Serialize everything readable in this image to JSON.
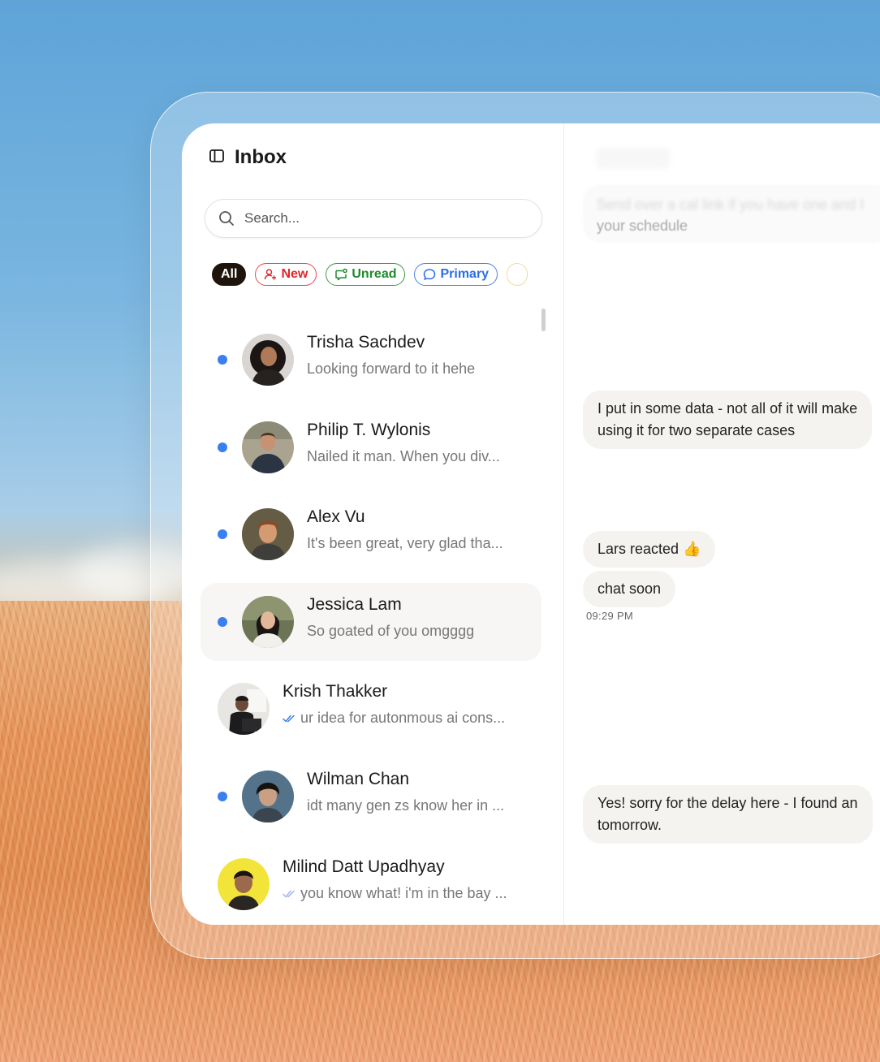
{
  "inbox": {
    "title": "Inbox",
    "search_placeholder": "Search...",
    "filters": [
      {
        "label": "All",
        "color": "#1f140b"
      },
      {
        "label": "New",
        "color": "#e02727"
      },
      {
        "label": "Unread",
        "color": "#1f8a2a"
      },
      {
        "label": "Primary",
        "color": "#2b6ee6"
      }
    ],
    "conversations": [
      {
        "name": "Trisha Sachdev",
        "preview": "Looking forward to it hehe",
        "unread": true
      },
      {
        "name": "Philip T. Wylonis",
        "preview": "Nailed it man.  When you div...",
        "unread": true
      },
      {
        "name": "Alex Vu",
        "preview": "It's been great, very glad tha...",
        "unread": true
      },
      {
        "name": "Jessica Lam",
        "preview": "So goated of you omgggg",
        "unread": true,
        "selected": true
      },
      {
        "name": "Krish Thakker",
        "preview": "ur idea for autonmous ai cons...",
        "unread": false,
        "read_receipt": true
      },
      {
        "name": "Wilman Chan",
        "preview": "idt many gen zs know her in ...",
        "unread": true
      },
      {
        "name": "Milind Datt Upadhyay",
        "preview": "you know what! i'm in the bay ...",
        "unread": false,
        "read_receipt": true
      }
    ]
  },
  "chat": {
    "faded_message_line1": "Send over a cal link if you have one and I",
    "faded_message_line2": "your schedule",
    "messages": [
      {
        "line1": "I put in some data - not all of it will make",
        "line2": "using it for two separate cases"
      },
      {
        "text": "Lars reacted 👍"
      },
      {
        "text": "chat soon"
      },
      {
        "line1": "Yes! sorry for the delay here - I found an",
        "line2": "tomorrow."
      }
    ],
    "timestamp": "09:29 PM"
  },
  "colors": {
    "unread_dot": "#3a7ff0",
    "read_receipt": "#3a7ff0",
    "bubble_bg": "#f5f3f0"
  }
}
